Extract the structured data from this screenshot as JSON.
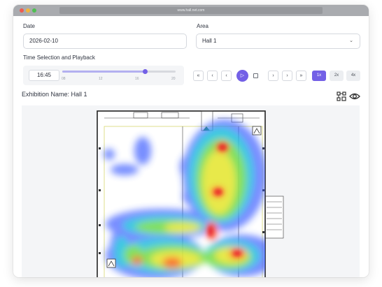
{
  "browser": {
    "url": "www.hall.net.com"
  },
  "form": {
    "date_label": "Date",
    "date_value": "2026-02-10",
    "area_label": "Area",
    "area_value": "Hall 1"
  },
  "playback": {
    "section_label": "Time Selection and Playback",
    "time_value": "16:45",
    "ticks": [
      "08",
      "12",
      "16",
      "20"
    ],
    "slider_value_hour": 16.75,
    "slider_range": [
      8,
      20
    ],
    "speeds": [
      {
        "label": "1x",
        "active": true
      },
      {
        "label": "2x",
        "active": false
      },
      {
        "label": "4x",
        "active": false
      }
    ]
  },
  "exhibition": {
    "name_label": "Exhibition Name: Hall 1"
  },
  "colors": {
    "accent": "#7360e6"
  }
}
